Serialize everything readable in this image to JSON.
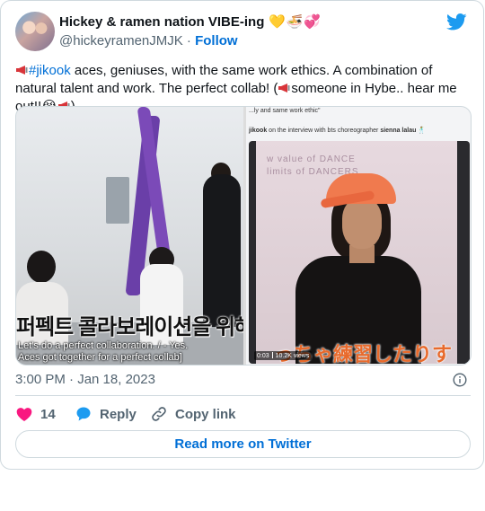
{
  "author": {
    "display_name": "Hickey & ramen nation VIBE-ing",
    "name_emojis": "💛🍜💞",
    "handle": "@hickeyramenJMJK",
    "separator": " · ",
    "follow_label": "Follow"
  },
  "tweet": {
    "hashtag": "#jikook",
    "text_part1": " aces, geniuses, with the same work ethics. A combination of natural talent and work. The perfect collab! (",
    "text_part2": "someone in Hybe.. hear me out!!😭",
    "text_part3": ")"
  },
  "media": {
    "left": {
      "korean_caption": "퍼펙트 콜라보레이션을 위해 뭉친 에이",
      "english_caption": "Let's do a perfect collaboration. / - Yes.\nAces got together for a perfect collab]"
    },
    "right": {
      "top_text": "...ly and same work ethic\"",
      "interview_handle": "jikook",
      "interview_text": " on the interview with bts choreographer ",
      "choreographer": "sienna lalau",
      "dancer_emoji": "🕺",
      "wall_text": "w value of DANCE\nlimits of DANCERS",
      "japanese_caption": "っちゃ練習したりす",
      "video_time": "0:03",
      "video_views": "10.2K views"
    }
  },
  "timestamp": "3:00 PM · Jan 18, 2023",
  "actions": {
    "like_count": "14",
    "reply_label": "Reply",
    "copy_label": "Copy link"
  },
  "read_more_label": "Read more on Twitter",
  "colors": {
    "link_blue": "#006fd6",
    "heart_red": "#f91880",
    "reply_blue": "#1d9bf0",
    "twitter_bird": "#1d9bf0"
  }
}
